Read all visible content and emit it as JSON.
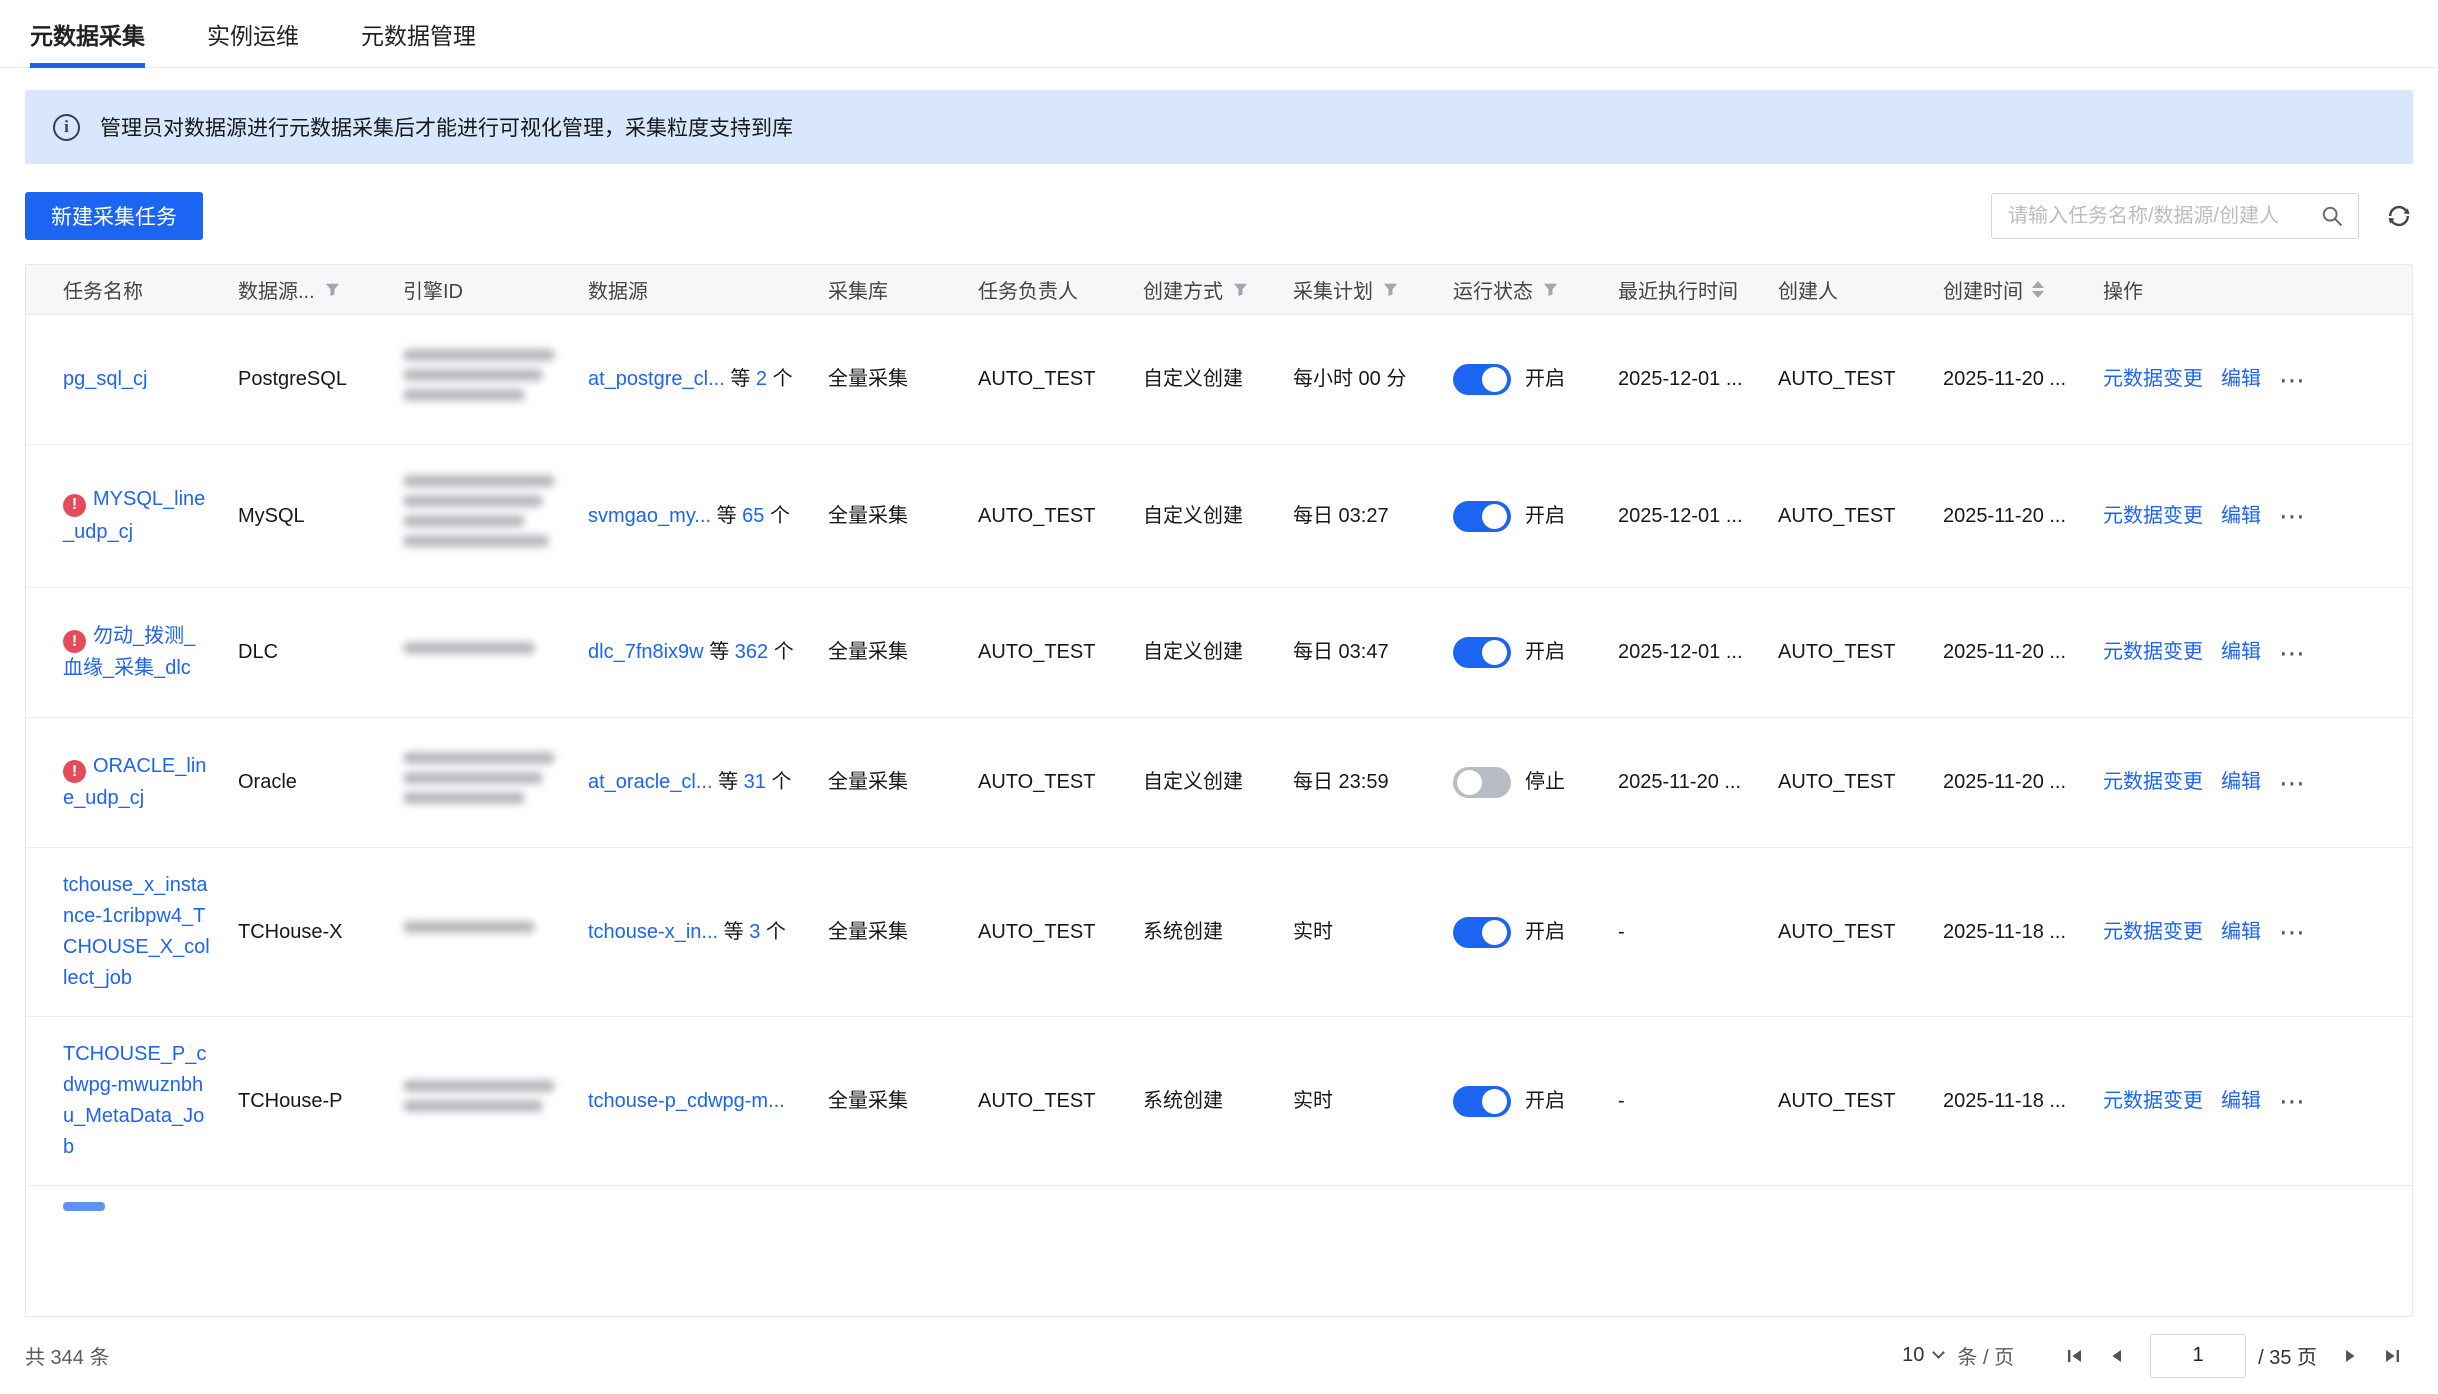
{
  "colors": {
    "accent": "#1c64f2",
    "banner_bg": "#d8e7fd",
    "warning": "#e34d59"
  },
  "tabs": [
    {
      "key": "metadata-collect",
      "label": "元数据采集",
      "active": true
    },
    {
      "key": "instance-ops",
      "label": "实例运维",
      "active": false
    },
    {
      "key": "metadata-manage",
      "label": "元数据管理",
      "active": false
    }
  ],
  "banner": {
    "text": "管理员对数据源进行元数据采集后才能进行可视化管理，采集粒度支持到库"
  },
  "toolbar": {
    "new_task": "新建采集任务",
    "search_placeholder": "请输入任务名称/数据源/创建人"
  },
  "table": {
    "count_before": "等",
    "count_after": "个",
    "row_actions": {
      "meta_change": "元数据变更",
      "edit": "编辑",
      "more": "⋯"
    },
    "columns": [
      {
        "key": "task-name",
        "label": "任务名称",
        "filter": false,
        "sort": false
      },
      {
        "key": "datasource-type",
        "label": "数据源...",
        "filter": true,
        "sort": false
      },
      {
        "key": "engine-id",
        "label": "引擎ID",
        "filter": false,
        "sort": false
      },
      {
        "key": "datasource",
        "label": "数据源",
        "filter": false,
        "sort": false
      },
      {
        "key": "collect-db",
        "label": "采集库",
        "filter": false,
        "sort": false
      },
      {
        "key": "owner",
        "label": "任务负责人",
        "filter": false,
        "sort": false
      },
      {
        "key": "create-mode",
        "label": "创建方式",
        "filter": true,
        "sort": false
      },
      {
        "key": "plan",
        "label": "采集计划",
        "filter": true,
        "sort": false
      },
      {
        "key": "status",
        "label": "运行状态",
        "filter": true,
        "sort": false
      },
      {
        "key": "last-run",
        "label": "最近执行时间",
        "filter": false,
        "sort": false
      },
      {
        "key": "creator",
        "label": "创建人",
        "filter": false,
        "sort": false
      },
      {
        "key": "created",
        "label": "创建时间",
        "filter": false,
        "sort": true
      },
      {
        "key": "actions",
        "label": "操作",
        "filter": false,
        "sort": false
      }
    ],
    "rows": [
      {
        "name": "pg_sql_cj",
        "warning": false,
        "type": "PostgreSQL",
        "engine_redacted_lines": 3,
        "datasource": "at_postgre_cl...",
        "datasource_count": "2",
        "collect_db": "全量采集",
        "owner": "AUTO_TEST",
        "create_mode": "自定义创建",
        "plan": "每小时 00 分",
        "status_on": true,
        "status_label": "开启",
        "last_run": "2025-12-01 ...",
        "creator": "AUTO_TEST",
        "created": "2025-11-20 ..."
      },
      {
        "name": "MYSQL_line_udp_cj",
        "warning": true,
        "type": "MySQL",
        "engine_redacted_lines": 4,
        "datasource": "svmgao_my...",
        "datasource_count": "65",
        "collect_db": "全量采集",
        "owner": "AUTO_TEST",
        "create_mode": "自定义创建",
        "plan": "每日 03:27",
        "status_on": true,
        "status_label": "开启",
        "last_run": "2025-12-01 ...",
        "creator": "AUTO_TEST",
        "created": "2025-11-20 ..."
      },
      {
        "name": "勿动_拨测_血缘_采集_dlc",
        "warning": true,
        "type": "DLC",
        "engine_redacted_lines": 1,
        "datasource": "dlc_7fn8ix9w",
        "datasource_count": "362",
        "collect_db": "全量采集",
        "owner": "AUTO_TEST",
        "create_mode": "自定义创建",
        "plan": "每日 03:47",
        "status_on": true,
        "status_label": "开启",
        "last_run": "2025-12-01 ...",
        "creator": "AUTO_TEST",
        "created": "2025-11-20 ..."
      },
      {
        "name": "ORACLE_line_udp_cj",
        "warning": true,
        "type": "Oracle",
        "engine_redacted_lines": 3,
        "datasource": "at_oracle_cl...",
        "datasource_count": "31",
        "collect_db": "全量采集",
        "owner": "AUTO_TEST",
        "create_mode": "自定义创建",
        "plan": "每日 23:59",
        "status_on": false,
        "status_label": "停止",
        "last_run": "2025-11-20 ...",
        "creator": "AUTO_TEST",
        "created": "2025-11-20 ..."
      },
      {
        "name": "tchouse_x_instance-1cribpw4_TCHOUSE_X_collect_job",
        "warning": false,
        "type": "TCHouse-X",
        "engine_redacted_lines": 1,
        "datasource": "tchouse-x_in...",
        "datasource_count": "3",
        "collect_db": "全量采集",
        "owner": "AUTO_TEST",
        "create_mode": "系统创建",
        "plan": "实时",
        "status_on": true,
        "status_label": "开启",
        "last_run": "-",
        "creator": "AUTO_TEST",
        "created": "2025-11-18 ..."
      },
      {
        "name": "TCHOUSE_P_cdwpg-mwuznbhu_MetaData_Job",
        "warning": false,
        "type": "TCHouse-P",
        "engine_redacted_lines": 2,
        "datasource": "tchouse-p_cdwpg-m...",
        "datasource_count": null,
        "collect_db": "全量采集",
        "owner": "AUTO_TEST",
        "create_mode": "系统创建",
        "plan": "实时",
        "status_on": true,
        "status_label": "开启",
        "last_run": "-",
        "creator": "AUTO_TEST",
        "created": "2025-11-18 ..."
      }
    ]
  },
  "footer": {
    "total": "共 344 条",
    "page_size": "10",
    "per_page": "条 / 页",
    "page": "1",
    "total_pages": "/ 35 页"
  }
}
